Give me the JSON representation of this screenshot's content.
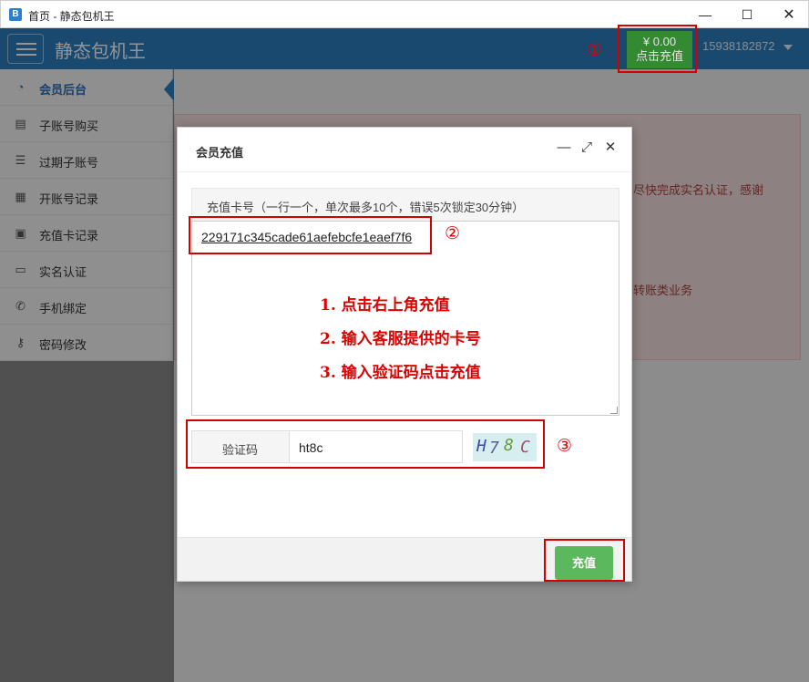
{
  "window": {
    "icon": "B",
    "title": "首页 - 静态包机王",
    "min": "—",
    "max": "☐",
    "close": "✕"
  },
  "header": {
    "brand": "静态包机王",
    "balance": "¥ 0.00",
    "recharge": "点击充值",
    "phone": "15938182872"
  },
  "sidebar": {
    "items": [
      {
        "label": "会员后台",
        "icon": "dashboard-icon"
      },
      {
        "label": "子账号购买",
        "icon": "server-icon"
      },
      {
        "label": "过期子账号",
        "icon": "list-icon"
      },
      {
        "label": "开账号记录",
        "icon": "table-icon"
      },
      {
        "label": "充值卡记录",
        "icon": "money-icon"
      },
      {
        "label": "实名认证",
        "icon": "id-card-icon"
      },
      {
        "label": "手机绑定",
        "icon": "phone-icon"
      },
      {
        "label": "密码修改",
        "icon": "key-icon"
      }
    ]
  },
  "alert": {
    "line1": "尽快完成实名认证，感谢",
    "line2": "转账类业务"
  },
  "modal": {
    "title": "会员充值",
    "card_label": "充值卡号（一行一个，单次最多10个，错误5次锁定30分钟）",
    "card_value": "229171c345cade61aefebcfe1eaef7f6",
    "instructions": [
      "1. 点击右上角充值",
      "2. 输入客服提供的卡号",
      "3. 输入验证码点击充值"
    ],
    "captcha_label": "验证码",
    "captcha_value": "ht8c",
    "captcha_image_text": "H78C",
    "submit": "充值"
  },
  "markers": [
    "①",
    "②",
    "③"
  ],
  "colors": {
    "topbar": "#2d7fc1",
    "recharge": "#3a9b3a",
    "submit": "#5cb85c",
    "highlight": "#d40000"
  }
}
